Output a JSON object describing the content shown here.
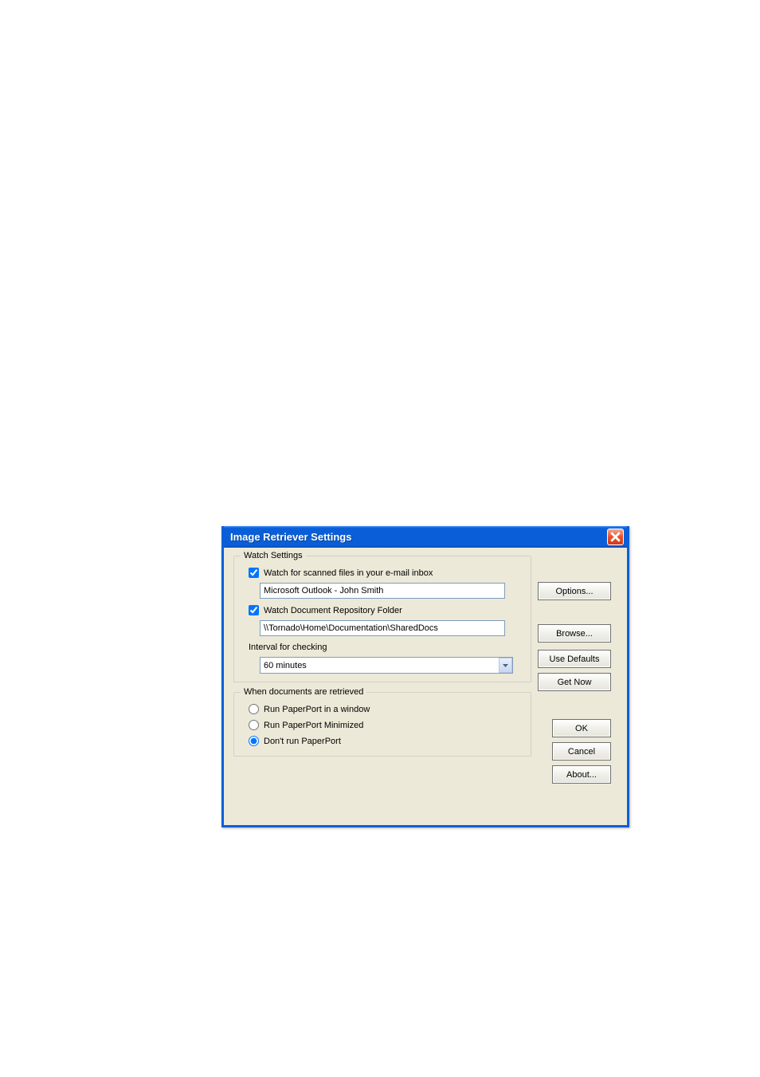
{
  "window": {
    "title": "Image Retriever Settings"
  },
  "watchSettings": {
    "legend": "Watch Settings",
    "emailCheckbox": {
      "checked": true,
      "label": "Watch for scanned files in your e-mail inbox"
    },
    "emailInput": "Microsoft Outlook - John Smith",
    "folderCheckbox": {
      "checked": true,
      "label": "Watch Document Repository Folder"
    },
    "folderInput": "\\\\Tornado\\Home\\Documentation\\SharedDocs",
    "intervalLabel": "Interval for checking",
    "intervalValue": "60 minutes"
  },
  "whenRetrieved": {
    "legend": "When documents are retrieved",
    "options": [
      {
        "label": "Run PaperPort in a window",
        "selected": false
      },
      {
        "label": "Run PaperPort Minimized",
        "selected": false
      },
      {
        "label": "Don't run PaperPort",
        "selected": true
      }
    ]
  },
  "buttons": {
    "options": "Options...",
    "browse": "Browse...",
    "useDefaults": "Use Defaults",
    "getNow": "Get Now",
    "ok": "OK",
    "cancel": "Cancel",
    "about": "About..."
  }
}
